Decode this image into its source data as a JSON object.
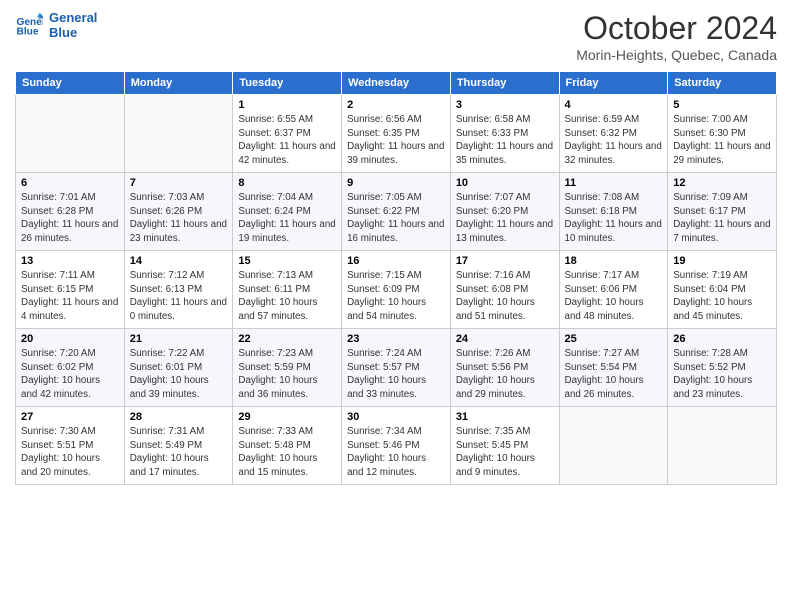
{
  "logo": {
    "line1": "General",
    "line2": "Blue"
  },
  "title": "October 2024",
  "subtitle": "Morin-Heights, Quebec, Canada",
  "days_of_week": [
    "Sunday",
    "Monday",
    "Tuesday",
    "Wednesday",
    "Thursday",
    "Friday",
    "Saturday"
  ],
  "weeks": [
    [
      {
        "day": "",
        "info": ""
      },
      {
        "day": "",
        "info": ""
      },
      {
        "day": "1",
        "info": "Sunrise: 6:55 AM\nSunset: 6:37 PM\nDaylight: 11 hours and 42 minutes."
      },
      {
        "day": "2",
        "info": "Sunrise: 6:56 AM\nSunset: 6:35 PM\nDaylight: 11 hours and 39 minutes."
      },
      {
        "day": "3",
        "info": "Sunrise: 6:58 AM\nSunset: 6:33 PM\nDaylight: 11 hours and 35 minutes."
      },
      {
        "day": "4",
        "info": "Sunrise: 6:59 AM\nSunset: 6:32 PM\nDaylight: 11 hours and 32 minutes."
      },
      {
        "day": "5",
        "info": "Sunrise: 7:00 AM\nSunset: 6:30 PM\nDaylight: 11 hours and 29 minutes."
      }
    ],
    [
      {
        "day": "6",
        "info": "Sunrise: 7:01 AM\nSunset: 6:28 PM\nDaylight: 11 hours and 26 minutes."
      },
      {
        "day": "7",
        "info": "Sunrise: 7:03 AM\nSunset: 6:26 PM\nDaylight: 11 hours and 23 minutes."
      },
      {
        "day": "8",
        "info": "Sunrise: 7:04 AM\nSunset: 6:24 PM\nDaylight: 11 hours and 19 minutes."
      },
      {
        "day": "9",
        "info": "Sunrise: 7:05 AM\nSunset: 6:22 PM\nDaylight: 11 hours and 16 minutes."
      },
      {
        "day": "10",
        "info": "Sunrise: 7:07 AM\nSunset: 6:20 PM\nDaylight: 11 hours and 13 minutes."
      },
      {
        "day": "11",
        "info": "Sunrise: 7:08 AM\nSunset: 6:18 PM\nDaylight: 11 hours and 10 minutes."
      },
      {
        "day": "12",
        "info": "Sunrise: 7:09 AM\nSunset: 6:17 PM\nDaylight: 11 hours and 7 minutes."
      }
    ],
    [
      {
        "day": "13",
        "info": "Sunrise: 7:11 AM\nSunset: 6:15 PM\nDaylight: 11 hours and 4 minutes."
      },
      {
        "day": "14",
        "info": "Sunrise: 7:12 AM\nSunset: 6:13 PM\nDaylight: 11 hours and 0 minutes."
      },
      {
        "day": "15",
        "info": "Sunrise: 7:13 AM\nSunset: 6:11 PM\nDaylight: 10 hours and 57 minutes."
      },
      {
        "day": "16",
        "info": "Sunrise: 7:15 AM\nSunset: 6:09 PM\nDaylight: 10 hours and 54 minutes."
      },
      {
        "day": "17",
        "info": "Sunrise: 7:16 AM\nSunset: 6:08 PM\nDaylight: 10 hours and 51 minutes."
      },
      {
        "day": "18",
        "info": "Sunrise: 7:17 AM\nSunset: 6:06 PM\nDaylight: 10 hours and 48 minutes."
      },
      {
        "day": "19",
        "info": "Sunrise: 7:19 AM\nSunset: 6:04 PM\nDaylight: 10 hours and 45 minutes."
      }
    ],
    [
      {
        "day": "20",
        "info": "Sunrise: 7:20 AM\nSunset: 6:02 PM\nDaylight: 10 hours and 42 minutes."
      },
      {
        "day": "21",
        "info": "Sunrise: 7:22 AM\nSunset: 6:01 PM\nDaylight: 10 hours and 39 minutes."
      },
      {
        "day": "22",
        "info": "Sunrise: 7:23 AM\nSunset: 5:59 PM\nDaylight: 10 hours and 36 minutes."
      },
      {
        "day": "23",
        "info": "Sunrise: 7:24 AM\nSunset: 5:57 PM\nDaylight: 10 hours and 33 minutes."
      },
      {
        "day": "24",
        "info": "Sunrise: 7:26 AM\nSunset: 5:56 PM\nDaylight: 10 hours and 29 minutes."
      },
      {
        "day": "25",
        "info": "Sunrise: 7:27 AM\nSunset: 5:54 PM\nDaylight: 10 hours and 26 minutes."
      },
      {
        "day": "26",
        "info": "Sunrise: 7:28 AM\nSunset: 5:52 PM\nDaylight: 10 hours and 23 minutes."
      }
    ],
    [
      {
        "day": "27",
        "info": "Sunrise: 7:30 AM\nSunset: 5:51 PM\nDaylight: 10 hours and 20 minutes."
      },
      {
        "day": "28",
        "info": "Sunrise: 7:31 AM\nSunset: 5:49 PM\nDaylight: 10 hours and 17 minutes."
      },
      {
        "day": "29",
        "info": "Sunrise: 7:33 AM\nSunset: 5:48 PM\nDaylight: 10 hours and 15 minutes."
      },
      {
        "day": "30",
        "info": "Sunrise: 7:34 AM\nSunset: 5:46 PM\nDaylight: 10 hours and 12 minutes."
      },
      {
        "day": "31",
        "info": "Sunrise: 7:35 AM\nSunset: 5:45 PM\nDaylight: 10 hours and 9 minutes."
      },
      {
        "day": "",
        "info": ""
      },
      {
        "day": "",
        "info": ""
      }
    ]
  ]
}
